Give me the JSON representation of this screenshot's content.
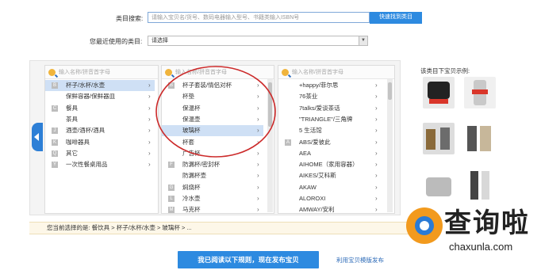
{
  "search": {
    "label": "类目搜索:",
    "placeholder": "请输入宝贝名/货号、数码电器输入型号、书籍类输入ISBN号",
    "button": "快速找到类目"
  },
  "recent": {
    "label": "您最近使用的类目:",
    "selected": "请选择"
  },
  "column_placeholder": "输入名称/拼音首字母",
  "col1": [
    {
      "letter": "B",
      "label": "杯子/水杯/水壶",
      "selected": true
    },
    {
      "letter": "",
      "label": "保鲜容器/保鲜器皿"
    },
    {
      "letter": "C",
      "label": "餐具"
    },
    {
      "letter": "",
      "label": "茶具"
    },
    {
      "letter": "J",
      "label": "酒壶/酒杯/酒具"
    },
    {
      "letter": "K",
      "label": "咖啡器具"
    },
    {
      "letter": "Q",
      "label": "其它"
    },
    {
      "letter": "Y",
      "label": "一次性餐桌用品"
    }
  ],
  "col2": [
    {
      "letter": "B",
      "label": "杯子套装/情侣对杯"
    },
    {
      "letter": "",
      "label": "杯垫"
    },
    {
      "letter": "",
      "label": "保温杯"
    },
    {
      "letter": "",
      "label": "保温壶"
    },
    {
      "letter": "",
      "label": "玻璃杯",
      "selected": true
    },
    {
      "letter": "",
      "label": "杯套"
    },
    {
      "letter": "",
      "label": "广告杯"
    },
    {
      "letter": "F",
      "label": "防漏杯/密封杯"
    },
    {
      "letter": "",
      "label": "防漏杯壶"
    },
    {
      "letter": "G",
      "label": "焖烧杯"
    },
    {
      "letter": "L",
      "label": "冷水壶"
    },
    {
      "letter": "M",
      "label": "马克杯"
    }
  ],
  "col3": [
    {
      "letter": "",
      "label": "+happy/菲尔思"
    },
    {
      "letter": "",
      "label": "76茶业"
    },
    {
      "letter": "",
      "label": "7talks/爱谈茶话"
    },
    {
      "letter": "",
      "label": "\"TRIANGLE\"/三角牌"
    },
    {
      "letter": "",
      "label": "5 生活馆"
    },
    {
      "letter": "A",
      "label": "ABS/爱彼此"
    },
    {
      "letter": "",
      "label": "AEA"
    },
    {
      "letter": "",
      "label": "AIHOME（家用容器）"
    },
    {
      "letter": "",
      "label": "AIKES/艾科斯"
    },
    {
      "letter": "",
      "label": "AKAW"
    },
    {
      "letter": "",
      "label": "ALOROXI"
    },
    {
      "letter": "",
      "label": "AMWAY/安利"
    }
  ],
  "examples": {
    "title": "该类目下宝贝示例:",
    "items": [
      "glass-teaset",
      "glass-tumbler",
      "wine-glasses",
      "water-bottle",
      "glass-cups-set",
      "thermos-bottle"
    ]
  },
  "current_path": {
    "text": "您当前选择的是: 餐饮具 > 杯子/水杯/水壶 > 玻璃杯 > ..."
  },
  "actions": {
    "publish": "我已阅读以下规则，现在发布宝贝",
    "template_link": "利用宝贝模版发布"
  },
  "watermark": {
    "brand": "查询啦",
    "url": "chaxunla.com"
  },
  "colors": {
    "accent": "#2d8ae0",
    "selected_row": "#cfe0f5",
    "annotation_circle": "#cc2a2a",
    "watermark_orange": "#f29a1e",
    "watermark_blue": "#2a7bd6"
  }
}
